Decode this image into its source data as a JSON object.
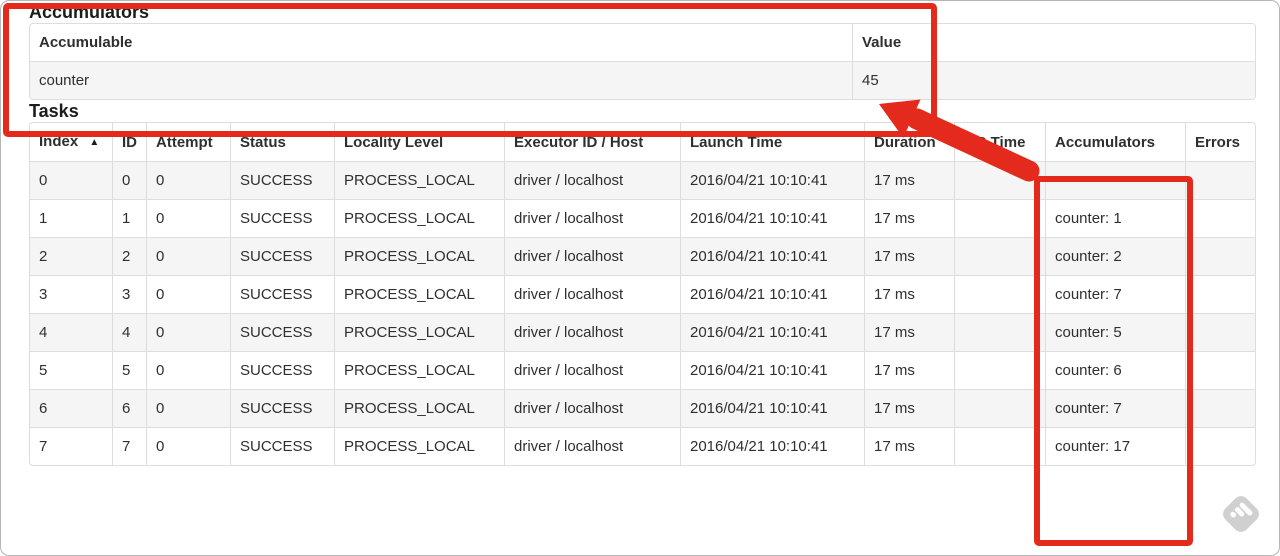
{
  "accumulators_section": {
    "title": "Accumulators",
    "headers": [
      "Accumulable",
      "Value"
    ],
    "rows": [
      [
        "counter",
        "45"
      ]
    ]
  },
  "tasks_section": {
    "title": "Tasks",
    "headers": [
      "Index",
      "ID",
      "Attempt",
      "Status",
      "Locality Level",
      "Executor ID / Host",
      "Launch Time",
      "Duration",
      "GC Time",
      "Accumulators",
      "Errors"
    ],
    "rows": [
      [
        "0",
        "0",
        "0",
        "SUCCESS",
        "PROCESS_LOCAL",
        "driver / localhost",
        "2016/04/21 10:10:41",
        "17 ms",
        "",
        "",
        ""
      ],
      [
        "1",
        "1",
        "0",
        "SUCCESS",
        "PROCESS_LOCAL",
        "driver / localhost",
        "2016/04/21 10:10:41",
        "17 ms",
        "",
        "counter: 1",
        ""
      ],
      [
        "2",
        "2",
        "0",
        "SUCCESS",
        "PROCESS_LOCAL",
        "driver / localhost",
        "2016/04/21 10:10:41",
        "17 ms",
        "",
        "counter: 2",
        ""
      ],
      [
        "3",
        "3",
        "0",
        "SUCCESS",
        "PROCESS_LOCAL",
        "driver / localhost",
        "2016/04/21 10:10:41",
        "17 ms",
        "",
        "counter: 7",
        ""
      ],
      [
        "4",
        "4",
        "0",
        "SUCCESS",
        "PROCESS_LOCAL",
        "driver / localhost",
        "2016/04/21 10:10:41",
        "17 ms",
        "",
        "counter: 5",
        ""
      ],
      [
        "5",
        "5",
        "0",
        "SUCCESS",
        "PROCESS_LOCAL",
        "driver / localhost",
        "2016/04/21 10:10:41",
        "17 ms",
        "",
        "counter: 6",
        ""
      ],
      [
        "6",
        "6",
        "0",
        "SUCCESS",
        "PROCESS_LOCAL",
        "driver / localhost",
        "2016/04/21 10:10:41",
        "17 ms",
        "",
        "counter: 7",
        ""
      ],
      [
        "7",
        "7",
        "0",
        "SUCCESS",
        "PROCESS_LOCAL",
        "driver / localhost",
        "2016/04/21 10:10:41",
        "17 ms",
        "",
        "counter: 17",
        ""
      ]
    ]
  },
  "icons": {
    "sort_ascending": "▲"
  },
  "annotations": {
    "highlight_color": "#e42a1c",
    "watermark_color": "#cbcbcb"
  }
}
